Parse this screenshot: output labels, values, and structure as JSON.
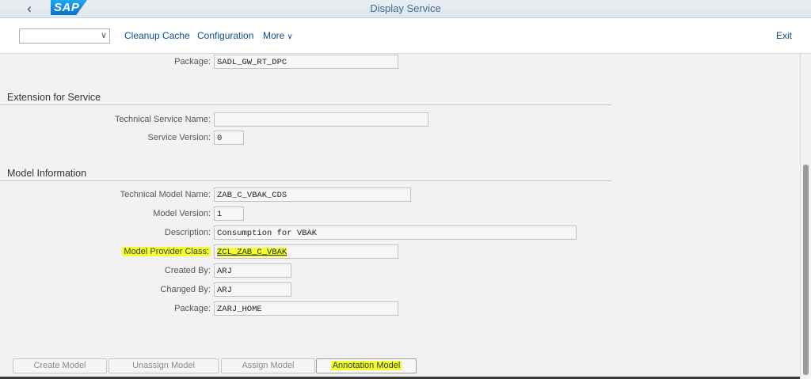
{
  "shell": {
    "logo": "SAP",
    "title": "Display Service"
  },
  "toolbar": {
    "combo_value": "",
    "cleanup_cache": "Cleanup Cache",
    "configuration": "Configuration",
    "more": "More",
    "exit": "Exit"
  },
  "top_package": {
    "label": "Package:",
    "value": "SADL_GW_RT_DPC"
  },
  "extension": {
    "title": "Extension for Service",
    "technical_service_name": {
      "label": "Technical Service Name:",
      "value": ""
    },
    "service_version": {
      "label": "Service Version:",
      "value": "0"
    }
  },
  "model": {
    "title": "Model Information",
    "technical_model_name": {
      "label": "Technical Model Name:",
      "value": "ZAB_C_VBAK_CDS"
    },
    "model_version": {
      "label": "Model Version:",
      "value": "1"
    },
    "description": {
      "label": "Description:",
      "value": "Consumption for VBAK"
    },
    "model_provider_class": {
      "label": "Model Provider Class:",
      "value": "ZCL_ZAB_C_VBAK"
    },
    "created_by": {
      "label": "Created By:",
      "value": "ARJ"
    },
    "changed_by": {
      "label": "Changed By:",
      "value": "ARJ"
    },
    "package": {
      "label": "Package:",
      "value": "ZARJ_HOME"
    }
  },
  "buttons": {
    "create_model": "Create Model",
    "unassign_model": "Unassign Model",
    "assign_model": "Assign Model",
    "annotation_model": "Annotation Model"
  },
  "colors": {
    "highlight": "#f2ff2c",
    "shell_bg": "#e4eaf0",
    "link": "#0e4e8e",
    "content_bg": "#f2f2f2"
  }
}
